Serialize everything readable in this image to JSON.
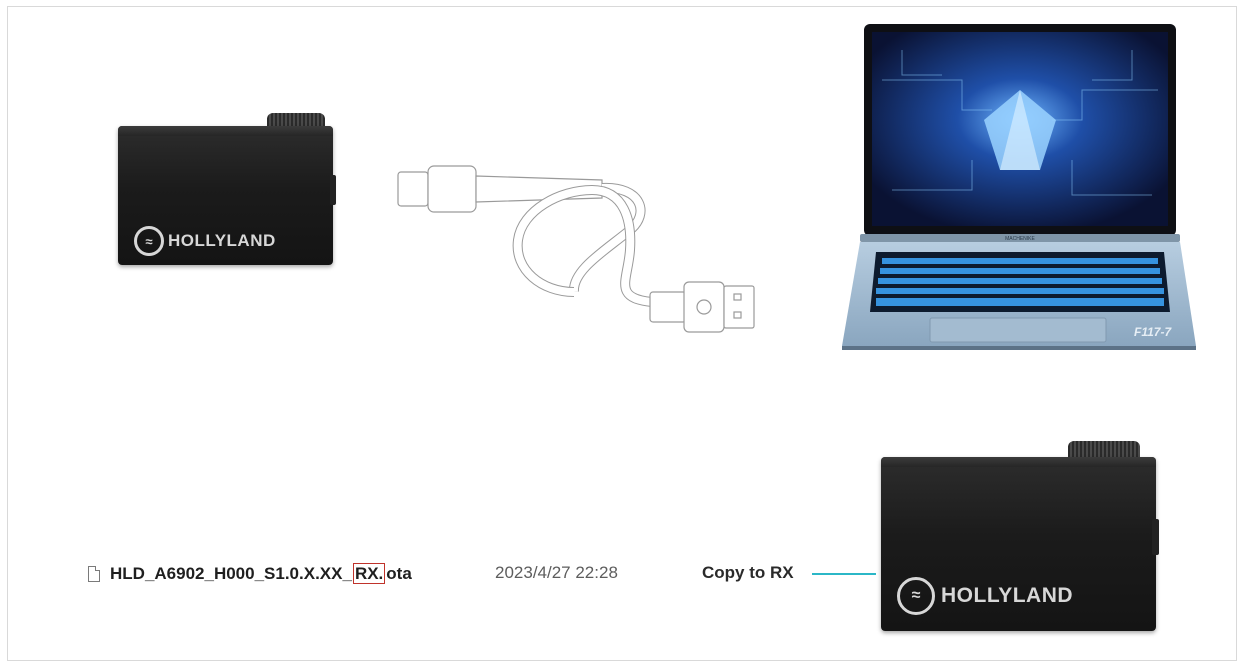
{
  "device_top": {
    "logo_text": "HOLLYLAND",
    "logo_symbol": "hollyland-logo-icon"
  },
  "cable": {
    "icon": "usb-c-to-usb-a-cable-icon"
  },
  "laptop": {
    "icon": "laptop-icon",
    "brand_text": "MACHENIKE",
    "model_text": "F117-7"
  },
  "file": {
    "name_prefix": "HLD_A6902_H000_S1.0.X.XX_",
    "name_highlight": "RX.",
    "name_suffix": "ota",
    "date": "2023/4/27 22:28",
    "icon": "file-icon"
  },
  "copy": {
    "label": "Copy to RX",
    "line_color": "#2bb7c7"
  },
  "device_bottom": {
    "logo_text": "HOLLYLAND",
    "logo_symbol": "hollyland-logo-icon"
  },
  "colors": {
    "highlight_box": "#c0332b",
    "device_body": "#1b1b1b"
  }
}
